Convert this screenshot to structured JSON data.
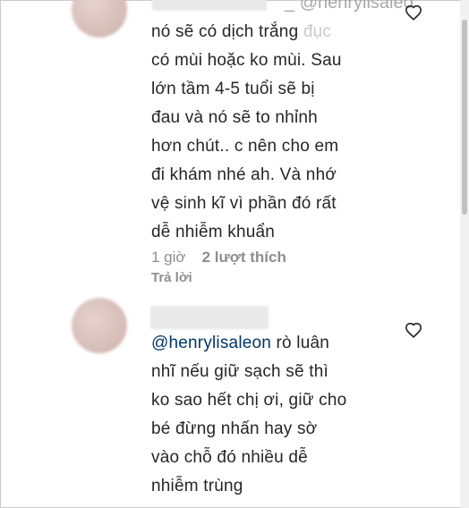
{
  "comments": [
    {
      "mention_top": "@henrylisaleo",
      "lines": [
        "nó sẽ có dịch trắng đục",
        "có mùi hoặc ko mùi. Sau",
        "lớn tầm 4-5 tuổi sẽ bị",
        "đau và nó sẽ to nhỉnh",
        "hơn chút.. c nên cho em",
        "đi khám nhé ah. Và nhớ",
        "vệ sinh kĩ vì phần đó rất",
        "dễ nhiễm khuẩn"
      ],
      "line1_main": "nó sẽ có dịch trắng",
      "line1_faded": " đục",
      "time": "1 giờ",
      "likes": "2 lượt thích",
      "reply": "Trả lời"
    },
    {
      "mention": "@henrylisaleon",
      "first_line_rest": " rò luân",
      "lines": [
        "nhĩ nếu giữ sạch sẽ thì",
        "ko sao hết chị ơi, giữ cho",
        "bé đừng nhấn hay sờ",
        "vào chỗ đó nhiều dễ",
        "nhiễm trùng"
      ]
    }
  ],
  "icons": {
    "like": "heart-outline-icon"
  },
  "colors": {
    "text": "#262626",
    "mention": "#00376b",
    "meta": "#8e8e8e"
  }
}
